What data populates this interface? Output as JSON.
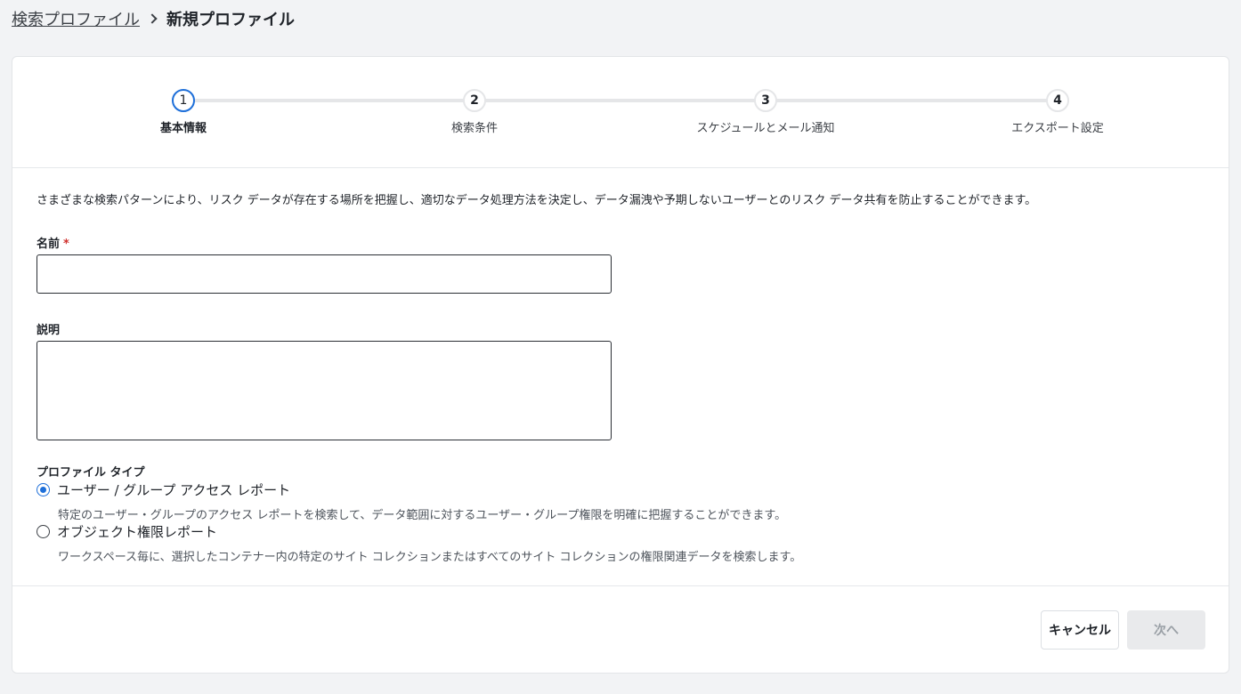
{
  "breadcrumb": {
    "parent": "検索プロファイル",
    "current": "新規プロファイル"
  },
  "stepper": {
    "steps": [
      {
        "number": "1",
        "label": "基本情報",
        "active": true
      },
      {
        "number": "2",
        "label": "検索条件",
        "active": false
      },
      {
        "number": "3",
        "label": "スケジュールとメール通知",
        "active": false
      },
      {
        "number": "4",
        "label": "エクスポート設定",
        "active": false
      }
    ]
  },
  "form": {
    "description": "さまざまな検索パターンにより、リスク データが存在する場所を把握し、適切なデータ処理方法を決定し、データ漏洩や予期しないユーザーとのリスク データ共有を防止することができます。",
    "name_label": "名前",
    "name_required": "*",
    "name_value": "",
    "description_label": "説明",
    "description_value": "",
    "profile_type_label": "プロファイル タイプ",
    "profile_types": [
      {
        "label": "ユーザー / グループ アクセス レポート",
        "help": "特定のユーザー・グループのアクセス レポートを検索して、データ範囲に対するユーザー・グループ権限を明確に把握することができます。",
        "selected": true
      },
      {
        "label": "オブジェクト権限レポート",
        "help": "ワークスペース毎に、選択したコンテナー内の特定のサイト コレクションまたはすべてのサイト コレクションの権限関連データを検索します。",
        "selected": false
      }
    ]
  },
  "footer": {
    "cancel_label": "キャンセル",
    "next_label": "次へ"
  },
  "colors": {
    "accent": "#1e6fd9",
    "required": "#d0312d",
    "page_bg": "#f2f3f5",
    "disabled_button_bg": "#e9eaec"
  }
}
